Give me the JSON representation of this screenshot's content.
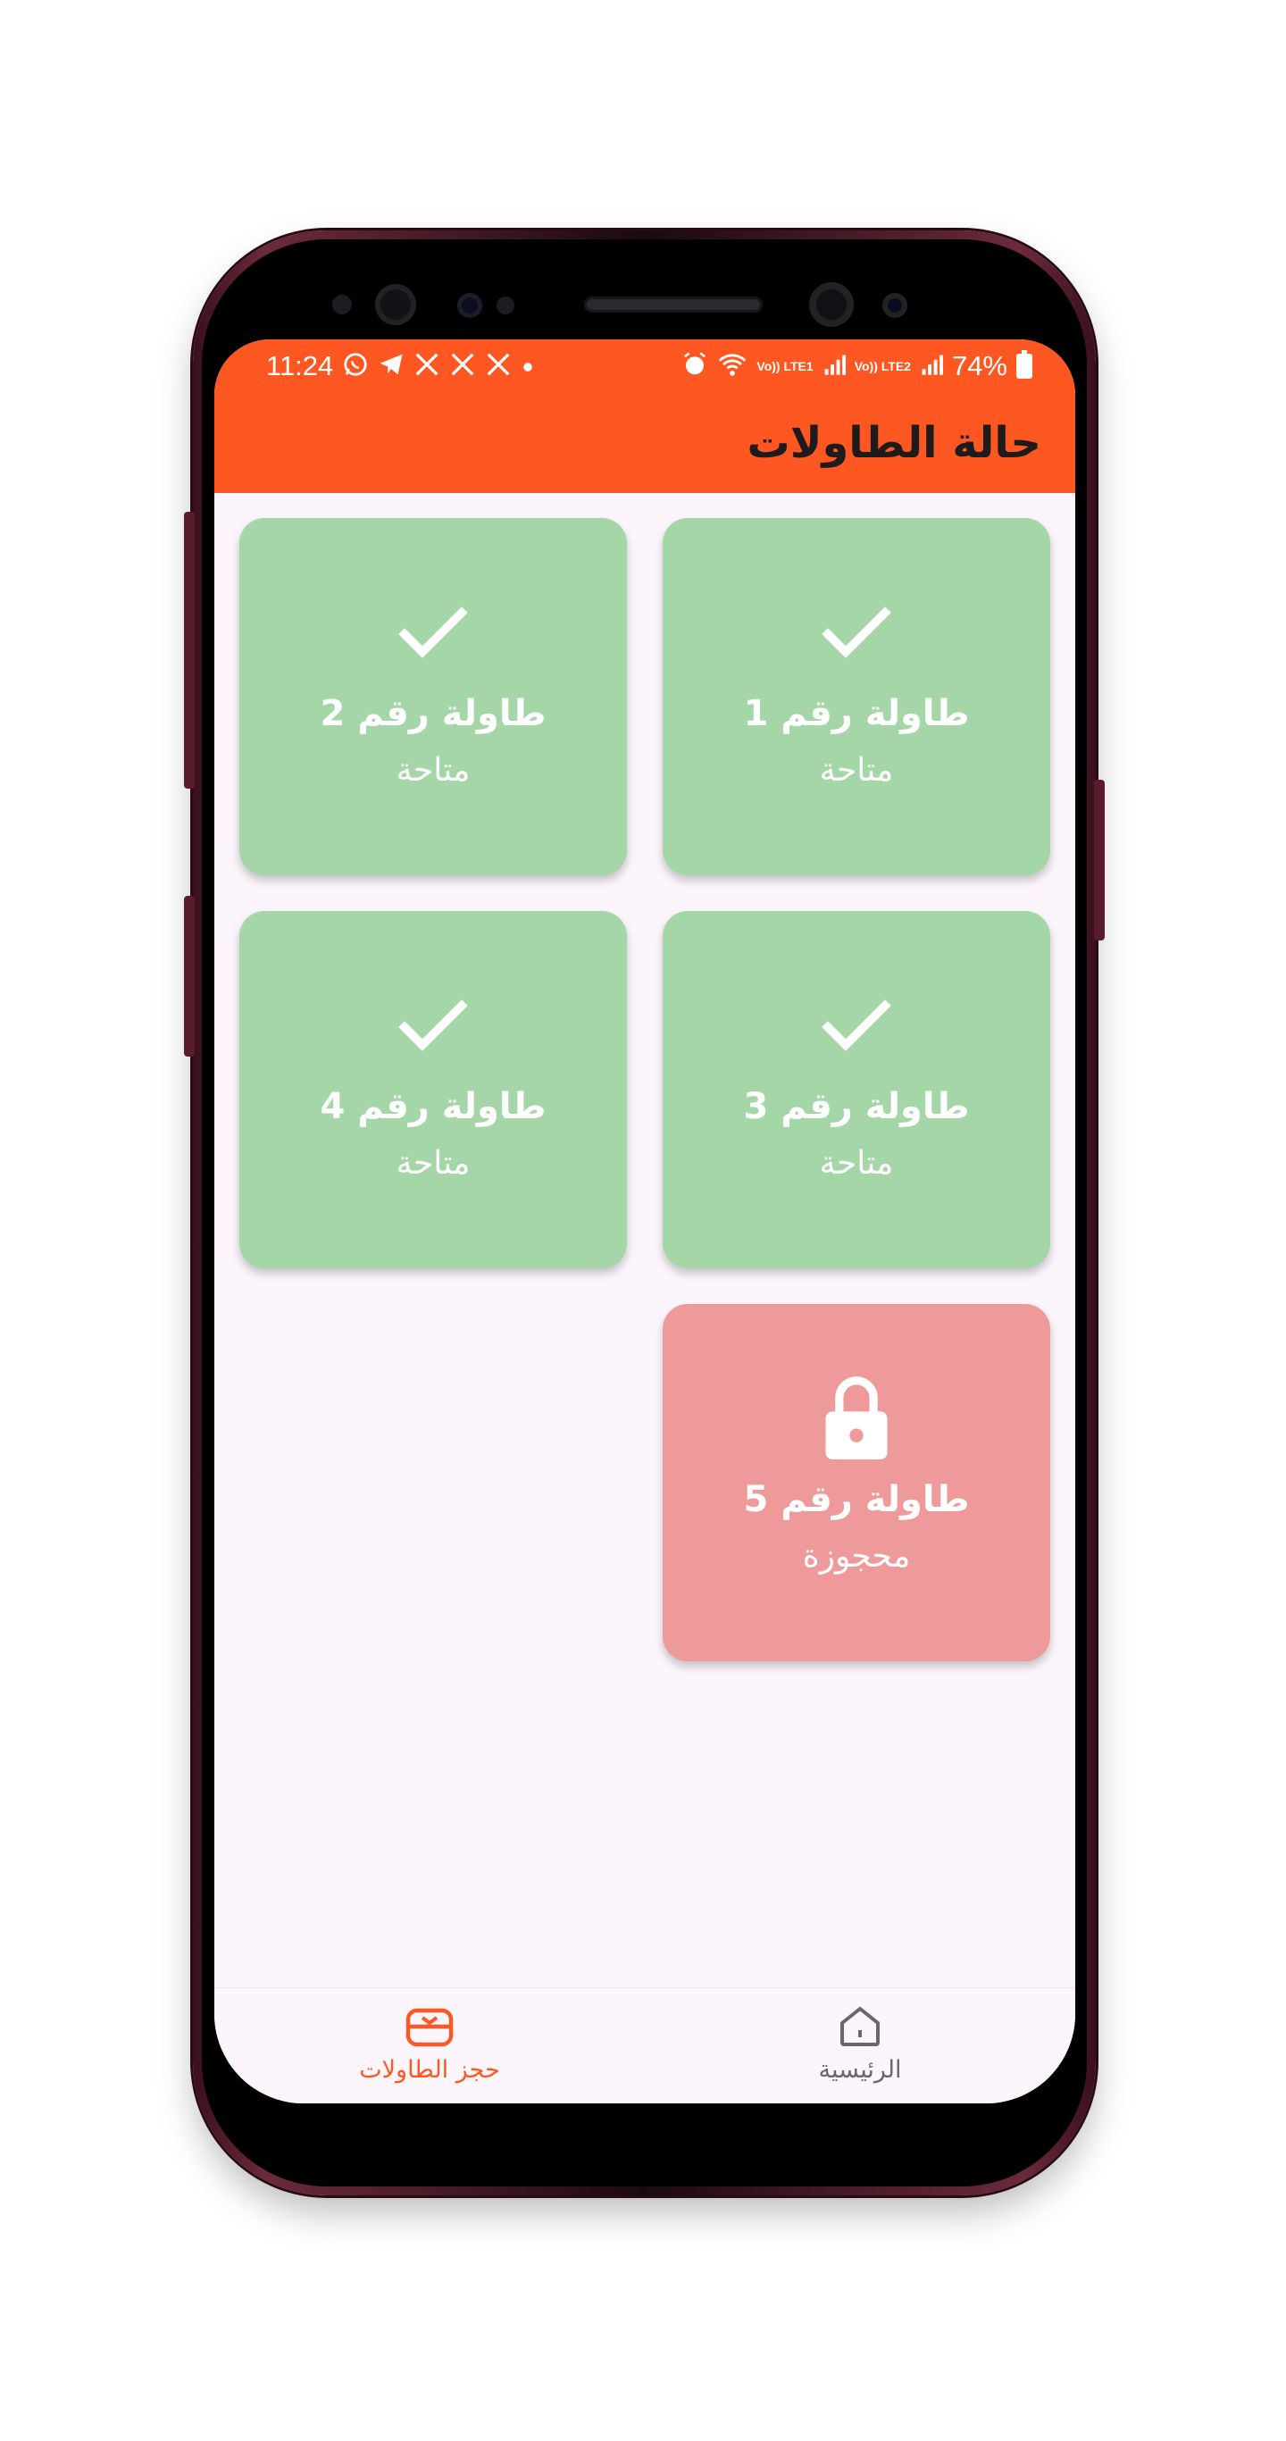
{
  "status_bar": {
    "time": "11:24",
    "left_icons": [
      "whatsapp-icon",
      "telegram-icon",
      "x-icon",
      "x-icon",
      "x-icon",
      "dot-icon"
    ],
    "right_icons": [
      "alarm-icon",
      "wifi-icon",
      "signal-lte1-icon",
      "signal-lte2-icon"
    ],
    "lte1": "Vo)) LTE1",
    "lte2": "Vo)) LTE2",
    "battery": "74%"
  },
  "app_bar": {
    "title": "حالة الطاولات",
    "color": "#ff5722"
  },
  "tables": [
    {
      "title": "طاولة رقم 1",
      "status": "متاحة",
      "icon": "check-icon",
      "color": "#a5d6a7"
    },
    {
      "title": "طاولة رقم 2",
      "status": "متاحة",
      "icon": "check-icon",
      "color": "#a5d6a7"
    },
    {
      "title": "طاولة رقم 3",
      "status": "متاحة",
      "icon": "check-icon",
      "color": "#a5d6a7"
    },
    {
      "title": "طاولة رقم 4",
      "status": "متاحة",
      "icon": "check-icon",
      "color": "#a5d6a7"
    },
    {
      "title": "طاولة رقم 5",
      "status": "محجوزة",
      "icon": "lock-icon",
      "color": "#ef9a9a"
    }
  ],
  "bottom_nav": {
    "items": [
      {
        "label": "حجز الطاولات",
        "icon": "table-booking-icon",
        "active": true
      },
      {
        "label": "الرئيسية",
        "icon": "home-icon",
        "active": false
      }
    ],
    "active_color": "#ff5722"
  }
}
